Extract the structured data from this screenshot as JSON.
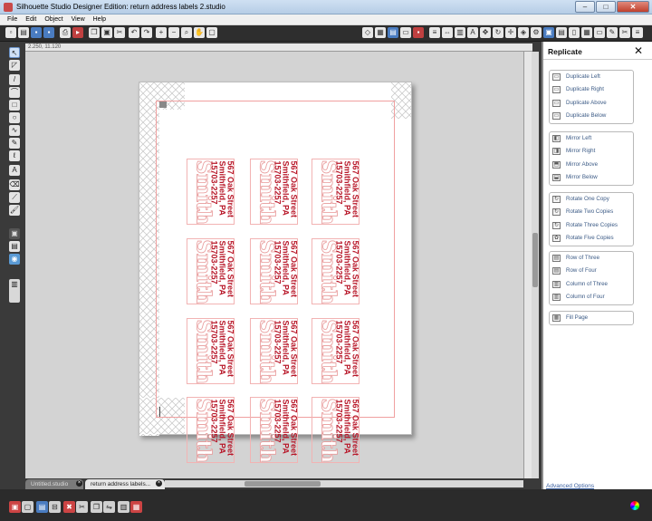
{
  "window": {
    "title": "Silhouette Studio Designer Edition: return address labels 2.studio",
    "minimize_icon": "minimize-icon",
    "maximize_icon": "maximize-icon",
    "close_icon": "close-icon"
  },
  "menu": {
    "items": [
      "File",
      "Edit",
      "Object",
      "View",
      "Help"
    ]
  },
  "ruler": {
    "coords": "2.250, 11.120"
  },
  "page": {
    "label": {
      "name": "Smith",
      "line1": "567 Oak Street",
      "line2": "Smithfield, PA",
      "line3": "15703-2257"
    }
  },
  "tabs": [
    {
      "label": "Untitled.studio"
    },
    {
      "label": "return address labels..."
    }
  ],
  "replicate_panel": {
    "title": "Replicate",
    "groups": [
      {
        "options": [
          {
            "label": "Duplicate Left",
            "icon": "duplicate-left-icon"
          },
          {
            "label": "Duplicate Right",
            "icon": "duplicate-right-icon"
          },
          {
            "label": "Duplicate Above",
            "icon": "duplicate-above-icon"
          },
          {
            "label": "Duplicate Below",
            "icon": "duplicate-below-icon"
          }
        ]
      },
      {
        "options": [
          {
            "label": "Mirror Left",
            "icon": "mirror-left-icon"
          },
          {
            "label": "Mirror Right",
            "icon": "mirror-right-icon"
          },
          {
            "label": "Mirror Above",
            "icon": "mirror-above-icon"
          },
          {
            "label": "Mirror Below",
            "icon": "mirror-below-icon"
          }
        ]
      },
      {
        "options": [
          {
            "label": "Rotate One Copy",
            "icon": "rotate-one-copy-icon"
          },
          {
            "label": "Rotate Two Copies",
            "icon": "rotate-two-copies-icon"
          },
          {
            "label": "Rotate Three Copies",
            "icon": "rotate-three-copies-icon"
          },
          {
            "label": "Rotate Five Copies",
            "icon": "rotate-five-copies-icon"
          }
        ]
      },
      {
        "options": [
          {
            "label": "Row of Three",
            "icon": "row-of-three-icon"
          },
          {
            "label": "Row of Four",
            "icon": "row-of-four-icon"
          },
          {
            "label": "Column of Three",
            "icon": "column-of-three-icon"
          },
          {
            "label": "Column of Four",
            "icon": "column-of-four-icon"
          }
        ]
      },
      {
        "options": [
          {
            "label": "Fill Page",
            "icon": "fill-page-icon"
          }
        ]
      }
    ],
    "advanced_link": "Advanced Options"
  },
  "colors": {
    "address_text": "#b8182a",
    "name_outline": "#e89a9a",
    "cut_border": "#f0a0a0",
    "panel_option_text": "#3c5b86",
    "workspace": "#d3d3d3"
  }
}
